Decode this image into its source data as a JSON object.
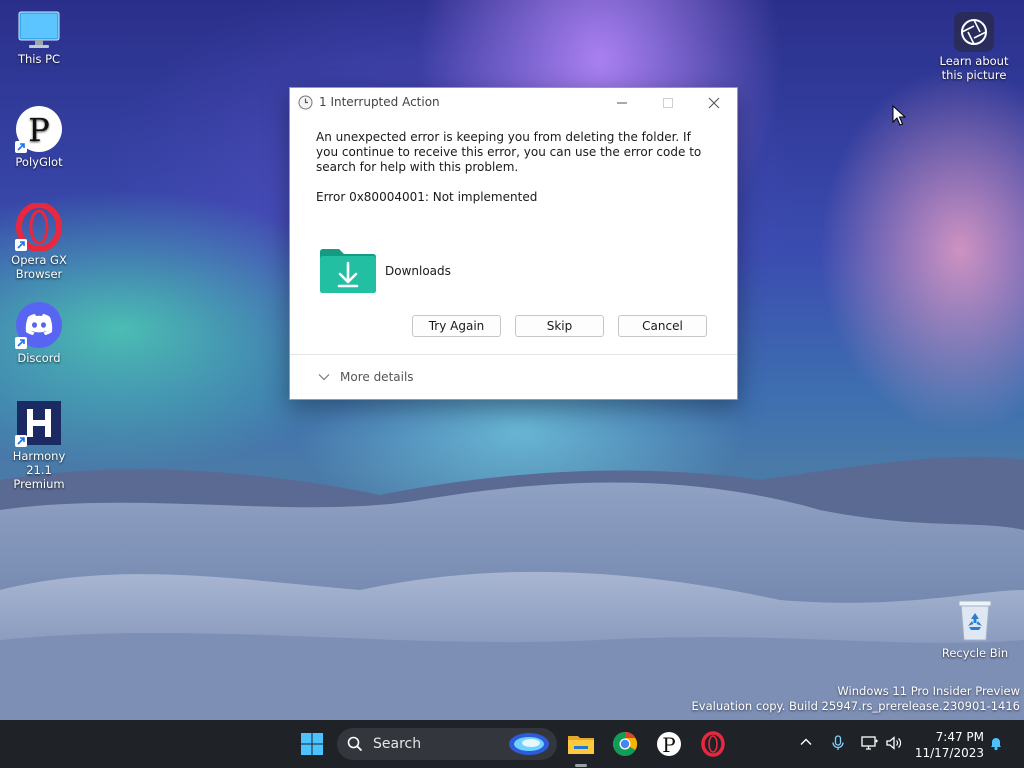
{
  "desktop": {
    "icons": [
      {
        "label": "This PC"
      },
      {
        "label": "PolyGlot"
      },
      {
        "label": "Opera GX Browser"
      },
      {
        "label": "Discord"
      },
      {
        "label": "Harmony 21.1 Premium"
      },
      {
        "label": "Recycle Bin"
      }
    ],
    "learn": {
      "line1": "Learn about",
      "line2": "this picture"
    },
    "watermark": {
      "line1": "Windows 11 Pro Insider Preview",
      "line2": "Evaluation copy. Build 25947.rs_prerelease.230901-1416"
    }
  },
  "dialog": {
    "title": "1 Interrupted Action",
    "message": "An unexpected error is keeping you from deleting the folder. If you continue to receive this error, you can use the error code to search for help with this problem.",
    "error": "Error 0x80004001: Not implemented",
    "item_name": "Downloads",
    "buttons": {
      "try_again": "Try Again",
      "skip": "Skip",
      "cancel": "Cancel"
    },
    "more_details": "More details",
    "colors": {
      "folder": "#1fae96"
    }
  },
  "taskbar": {
    "search_placeholder": "Search",
    "time": "7:47 PM",
    "date": "11/17/2023",
    "pinned": [
      "start-icon",
      "search",
      "copilot-icon",
      "file-explorer-icon",
      "chrome-icon",
      "polyglot-icon",
      "opera-icon"
    ],
    "tray": [
      "chevron-up-icon",
      "microphone-icon",
      "network-icon",
      "volume-icon",
      "notification-bell-icon"
    ]
  }
}
